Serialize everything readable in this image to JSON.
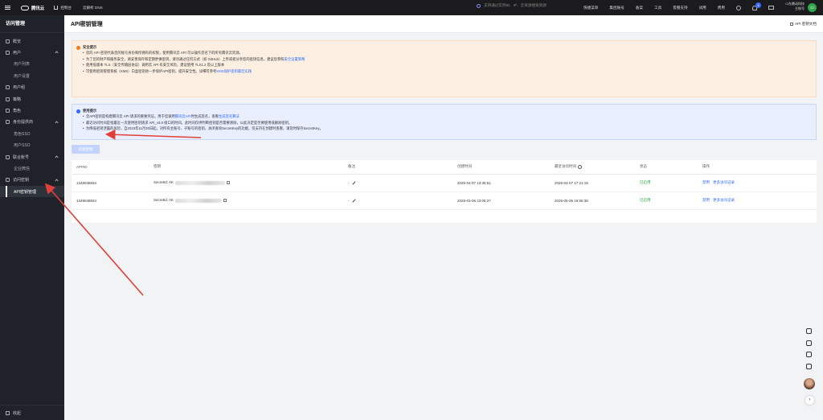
{
  "topbar": {
    "brand": "腾讯云",
    "console": "控制台",
    "dns": "云解析 DNS",
    "search_placeholder": "支持通过实例ID、IP、云资源搜索资源",
    "shortcut": "快捷菜单",
    "items": [
      "集团账号",
      "备案",
      "工具",
      "客服支持",
      "试用",
      "费用"
    ],
    "bell_count": "4",
    "user_line1": "Ci东鼎动科技",
    "user_line2": "主账号",
    "avatar_text": "Ci"
  },
  "sidebar": {
    "title": "访问管理",
    "items": {
      "overview": "概览",
      "user": "用户",
      "user_list": "用户列表",
      "user_settings": "用户设置",
      "user_group": "用户组",
      "policy": "策略",
      "role": "角色",
      "idp": "身份提供商",
      "role_sso": "角色SSO",
      "user_sso": "用户SSO",
      "federated": "联合账号",
      "enterprise_wechat": "企业微信",
      "access_key": "访问密钥",
      "api_key_mgmt": "API密钥管理"
    },
    "collapse": "收起"
  },
  "page": {
    "title": "API密钥管理",
    "doc_link": "API 密钥文档"
  },
  "alert_warn": {
    "title": "安全提示",
    "lines": [
      "您的 API 密钥代表您的账号身份和所拥有的权限，使用腾讯云 API 可以操作您名下的所有腾讯云资源。",
      "为了您的财产和服务安全，请妥善保存和定期更换密钥，请勿通过任何方式（如 GitHub）上传或者分享您的密钥信息。建议您参照",
      "使用低版本 TLS（安全传输层协议）调用云 API 有安全风险，建议使用 TLS1.2 及以上版本",
      "可使用密钥管理系统（KMS）白盒密钥进一步保护API密钥，提升安全性。详细可参考"
    ],
    "link1": "安全设置策略",
    "link2": "KMS保护密钥最佳实践"
  },
  "alert_info": {
    "title": "使用提示",
    "lines": [
      "云API密钥是构建腾讯云 API 请求的重要凭证。用于您调用",
      "最近访问时间是指最近一次使用密钥请求 API_v3.0 接口的时间。此时间仅供判断密钥是否需要清除，以此决定是否要使用或删除密钥。",
      "为降低密钥泄露的风险，自2023年11月30日起，对所有主账号、子账号的密钥，关闭查询SecretKey的功能，仅支持在创建时查看，请及时保存SecretKey。"
    ],
    "link1": "腾讯云API",
    "mid": "时生成签名，查看",
    "link2": "生成签名算法"
  },
  "create_button": "新建密钥",
  "table": {
    "headers": {
      "appid": "APPID",
      "key": "密钥",
      "remark": "备注",
      "created": "创建时间",
      "last_access": "最近访问时间",
      "status": "状态",
      "ops": "操作"
    },
    "rows": [
      {
        "appid": "1349048834",
        "key_prefix": "SecretId: AK",
        "remark": "-",
        "created": "2025-04-07 13:35:51",
        "last_access": "2025-04-07 17:21:19",
        "status": "已启用",
        "op_disable": "禁用",
        "op_more": "更多访问记录"
      },
      {
        "appid": "1349048834",
        "key_prefix": "SecretId: AK",
        "remark": "-",
        "created": "2025-03-06 23:05:27",
        "last_access": "2025-05-06 16:55:38",
        "status": "已启用",
        "op_disable": "禁用",
        "op_more": "更多访问记录"
      }
    ]
  },
  "colors": {
    "topbar": "#1b1b1d",
    "sidebar": "#1f2329",
    "link": "#2f68ff",
    "status_green": "#29a745",
    "annotation_arrow": "#e0403a"
  }
}
